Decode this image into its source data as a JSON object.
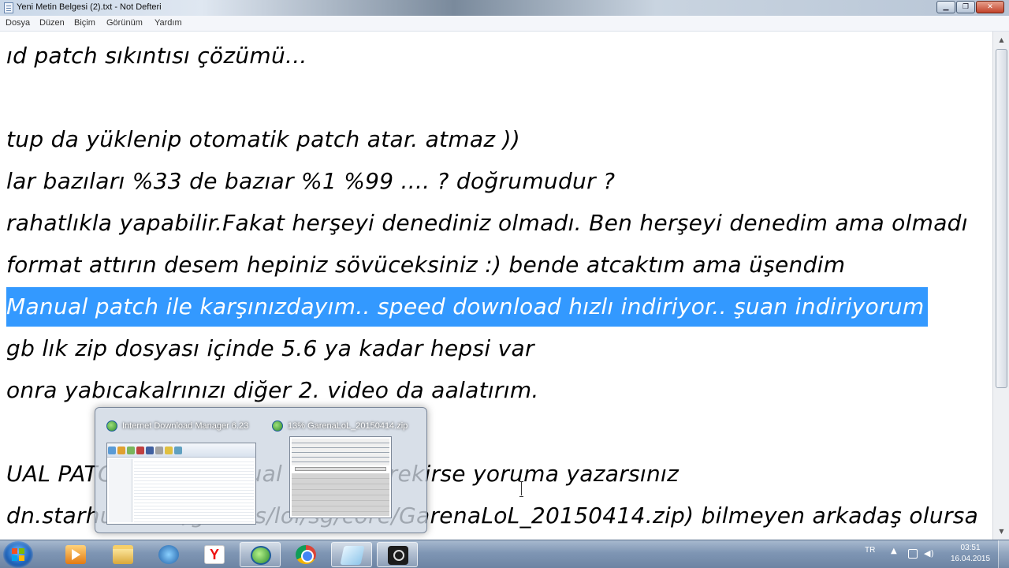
{
  "window": {
    "title": "Yeni Metin Belgesi (2).txt - Not Defteri",
    "controls": {
      "minimize": "▁",
      "maximize": "❐",
      "close": "✕"
    }
  },
  "menu": {
    "items": [
      "Dosya",
      "Düzen",
      "Biçim",
      "Görünüm",
      "Yardım"
    ]
  },
  "editor": {
    "lines": [
      "ıd  patch sıkıntısı çözümü...",
      "",
      "tup da yüklenip otomatik patch atar. atmaz ))",
      "lar bazıları %33 de bazıar %1 %99 .... ? doğrumudur ?",
      "rahatlıkla yapabilir.Fakat herşeyi denediniz olmadı. Ben herşeyi denedim ama olmadı",
      " format attırın desem hepiniz sövüceksiniz :) bende atcaktım ama üşendim",
      "Manual patch ile karşınızdayım.. speed download hızlı indiriyor.. şuan indiriyorum",
      " gb lık zip dosyası içinde 5.6 ya kadar hepsi var",
      "onra yabıcakalrınızı diğer 2. video da aalatırım.",
      "",
      "",
      "UAL PATCH (5.7) manual patch gerekirse yoruma yazarsınız",
      "dn.starhub.com/games/lol/sg/core/GarenaLoL_20150414.zip) bilmeyen arkadaş olursa"
    ],
    "selected_line_index": 6
  },
  "thumbnail_popup": {
    "windows": [
      {
        "title": "Internet Download Manager 6.23",
        "icon": "idm-globe-icon"
      },
      {
        "title": "13% GarenaLoL_20150414.zip",
        "icon": "idm-globe-icon"
      }
    ]
  },
  "taskbar": {
    "items": [
      {
        "name": "media-player",
        "icon": "media-player-icon"
      },
      {
        "name": "explorer",
        "icon": "folder-icon"
      },
      {
        "name": "idm",
        "icon": "idm-icon"
      },
      {
        "name": "yandex",
        "icon": "yandex-icon",
        "glyph": "Y"
      },
      {
        "name": "idm-globe",
        "icon": "idm-globe-icon",
        "active": true
      },
      {
        "name": "chrome",
        "icon": "chrome-icon"
      },
      {
        "name": "notepad",
        "icon": "notepad-icon",
        "active": true
      },
      {
        "name": "recorder",
        "icon": "camera-icon",
        "active": true
      }
    ],
    "tray": {
      "language": "TR",
      "time": "03:51",
      "date": "16.04.2015"
    }
  },
  "colors": {
    "selection": "#3399ff",
    "text": "#000000",
    "taskbar": "#7f96b4"
  }
}
